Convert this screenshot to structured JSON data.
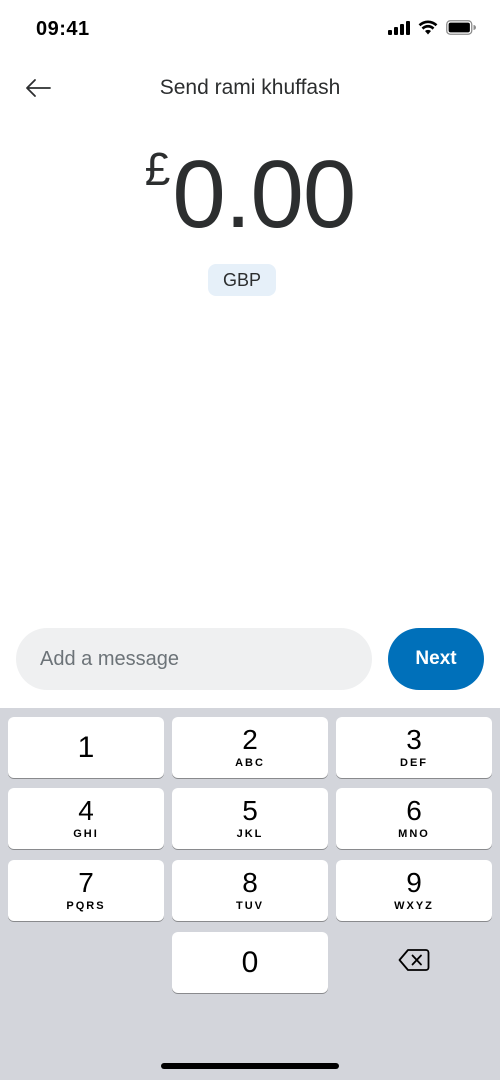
{
  "status_bar": {
    "time": "09:41",
    "icons": [
      "cellular-signal-icon",
      "wifi-icon",
      "battery-icon"
    ]
  },
  "header": {
    "back_icon": "arrow-left-icon",
    "title": "Send rami khuffash"
  },
  "amount": {
    "currency_symbol": "£",
    "value": "0.00",
    "currency_code": "GBP"
  },
  "message": {
    "placeholder": "Add a message",
    "value": ""
  },
  "next_button": {
    "label": "Next"
  },
  "keypad": {
    "keys": [
      {
        "digit": "1",
        "letters": ""
      },
      {
        "digit": "2",
        "letters": "ABC"
      },
      {
        "digit": "3",
        "letters": "DEF"
      },
      {
        "digit": "4",
        "letters": "GHI"
      },
      {
        "digit": "5",
        "letters": "JKL"
      },
      {
        "digit": "6",
        "letters": "MNO"
      },
      {
        "digit": "7",
        "letters": "PQRS"
      },
      {
        "digit": "8",
        "letters": "TUV"
      },
      {
        "digit": "9",
        "letters": "WXYZ"
      },
      {
        "digit": "0",
        "letters": ""
      }
    ],
    "delete_icon": "backspace-icon"
  },
  "colors": {
    "accent": "#0070ba",
    "chip_background": "#e6f0f9",
    "input_background": "#eff0f1",
    "keypad_background": "#d3d5db",
    "text": "#2c2e2f"
  }
}
